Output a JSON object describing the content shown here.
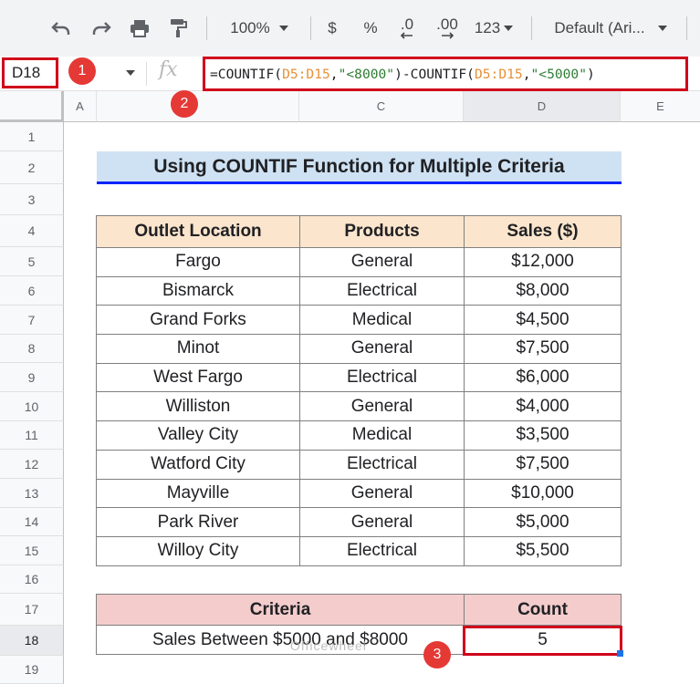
{
  "toolbar": {
    "zoom": "100%",
    "currency": "$",
    "percent": "%",
    "decrease_decimal": ".0",
    "increase_decimal": ".00",
    "number_format": "123",
    "font": "Default (Ari..."
  },
  "formula_bar": {
    "name_box": "D18",
    "fx": "fx",
    "formula": {
      "p1": "=COUNTIF(",
      "r1": "D5:D15",
      "p2": ",",
      "s1": "\"<8000\"",
      "p3": ")-COUNTIF(",
      "r2": "D5:D15",
      "p4": ",",
      "s2": "\"<5000\"",
      "p5": ")"
    }
  },
  "badges": [
    "1",
    "2",
    "3"
  ],
  "columns": [
    "A",
    "C",
    "D",
    "E"
  ],
  "rows": [
    "1",
    "2",
    "3",
    "4",
    "5",
    "6",
    "7",
    "8",
    "9",
    "10",
    "11",
    "12",
    "13",
    "14",
    "15",
    "16",
    "17",
    "18",
    "19"
  ],
  "title": "Using COUNTIF Function for Multiple Criteria",
  "table": {
    "headers": [
      "Outlet Location",
      "Products",
      "Sales ($)"
    ],
    "rows": [
      [
        "Fargo",
        "General",
        "$12,000"
      ],
      [
        "Bismarck",
        "Electrical",
        "$8,000"
      ],
      [
        "Grand Forks",
        "Medical",
        "$4,500"
      ],
      [
        "Minot",
        "General",
        "$7,500"
      ],
      [
        "West Fargo",
        "Electrical",
        "$6,000"
      ],
      [
        "Williston",
        "General",
        "$4,000"
      ],
      [
        "Valley City",
        "Medical",
        "$3,500"
      ],
      [
        "Watford City",
        "Electrical",
        "$7,500"
      ],
      [
        "Mayville",
        "General",
        "$10,000"
      ],
      [
        "Park River",
        "General",
        "$5,000"
      ],
      [
        "Willoy City",
        "Electrical",
        "$5,500"
      ]
    ]
  },
  "criteria": {
    "headers": [
      "Criteria",
      "Count"
    ],
    "label": "Sales Between $5000 and $8000",
    "count": "5"
  },
  "watermark": "Officewheel",
  "colors": {
    "highlight": "#d0021b",
    "badge": "#e53935",
    "title_bg": "#cfe2f3",
    "header_bg": "#fce5cd",
    "criteria_bg": "#f4cccc",
    "title_underline": "#0b24fb"
  }
}
